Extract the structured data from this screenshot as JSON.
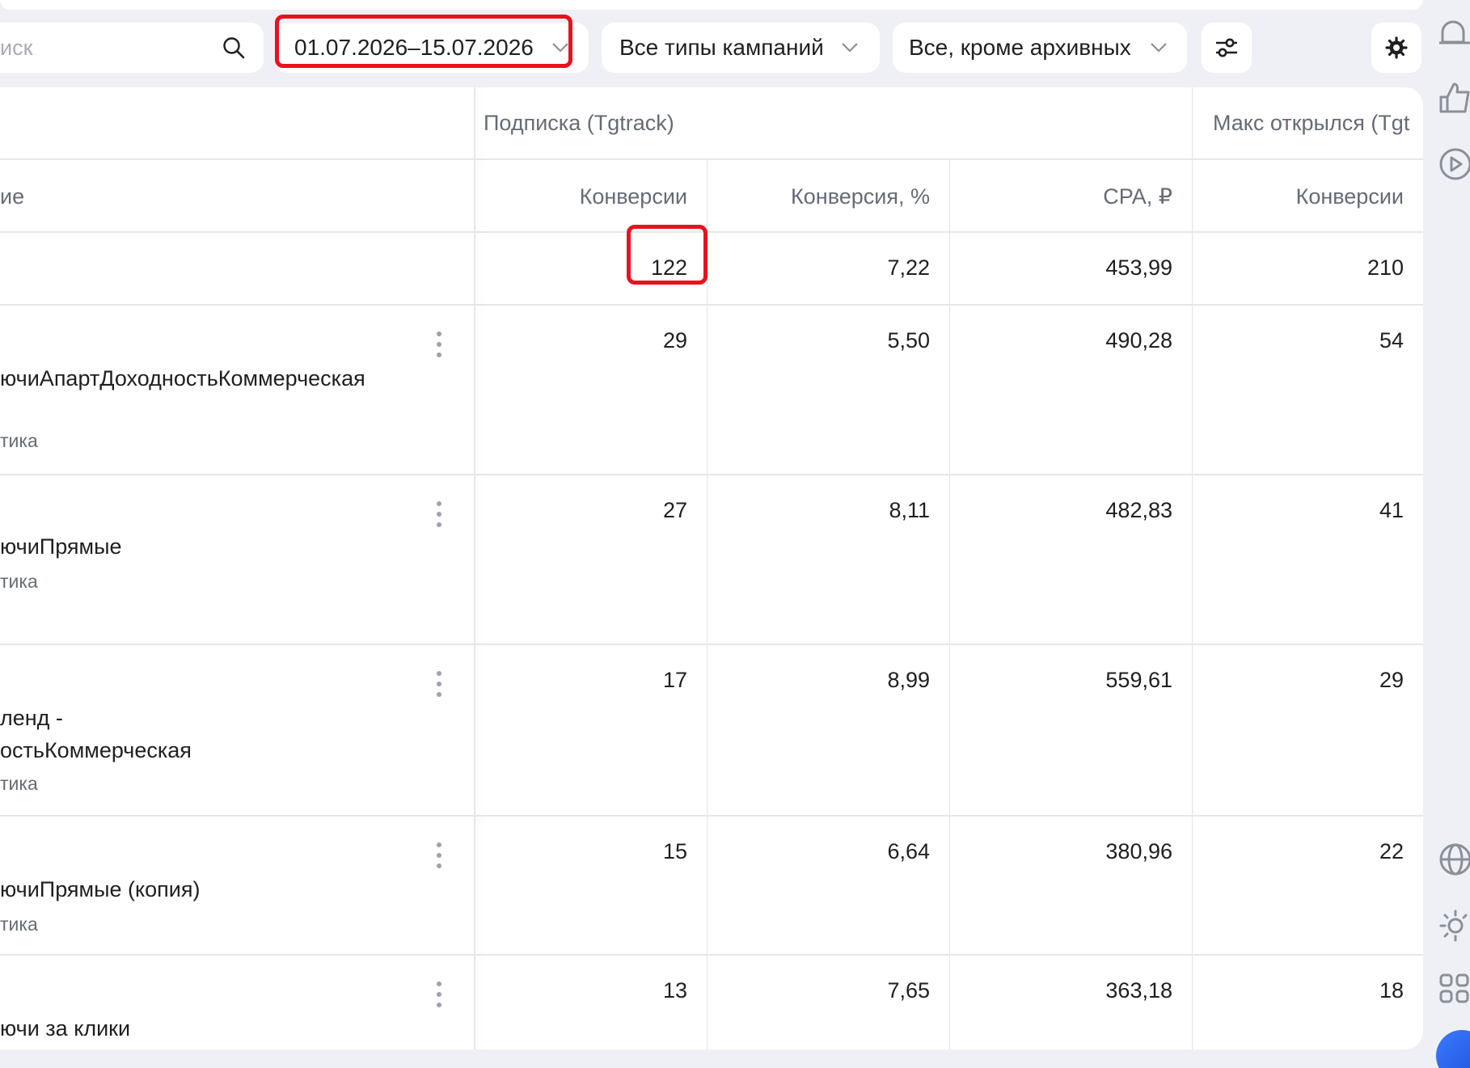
{
  "filters": {
    "search_placeholder": "иск",
    "date_range": "01.07.2026–15.07.2026",
    "campaign_types": "Все типы кампаний",
    "status": "Все, кроме архивных"
  },
  "colors": {
    "highlight": "#e8121e",
    "muted_text": "#656b76",
    "background": "#eef0f5"
  },
  "table": {
    "name_header": "ие",
    "groups": [
      "Подписка (Tgtrack)",
      "Макс открылся (Tgt"
    ],
    "columns": [
      "Конверсии",
      "Конверсия, %",
      "CPA, ₽",
      "Конверсии"
    ],
    "total": [
      "122",
      "7,22",
      "453,99",
      "210"
    ],
    "rows": [
      {
        "name": [
          "ючиАпартДоходностьКоммерческая"
        ],
        "sub": "тика",
        "values": [
          "29",
          "5,50",
          "490,28",
          "54"
        ]
      },
      {
        "name": [
          "ючиПрямые"
        ],
        "sub": "тика",
        "values": [
          "27",
          "8,11",
          "482,83",
          "41"
        ]
      },
      {
        "name": [
          " ленд -",
          "остьКоммерческая"
        ],
        "sub": "тика",
        "values": [
          "17",
          "8,99",
          "559,61",
          "29"
        ]
      },
      {
        "name": [
          "ючиПрямые (копия)"
        ],
        "sub": "тика",
        "values": [
          "15",
          "6,64",
          "380,96",
          "22"
        ]
      },
      {
        "name": [
          "ючи за клики"
        ],
        "sub": "",
        "values": [
          "13",
          "7,65",
          "363,18",
          "18"
        ]
      }
    ]
  },
  "icons": [
    "search-icon",
    "chevron-down-icon",
    "sliders-icon",
    "gear-icon",
    "bell-icon",
    "thumb-up-icon",
    "play-circle-icon",
    "globe-icon",
    "sun-icon",
    "apps-icon"
  ]
}
